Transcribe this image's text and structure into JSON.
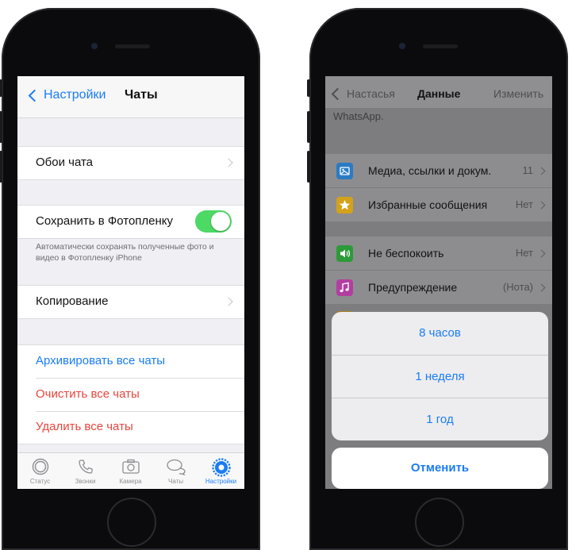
{
  "left_screen": {
    "nav": {
      "back_label": "Настройки",
      "title": "Чаты"
    },
    "wallpaper_label": "Обои чата",
    "save_to_camera_roll": {
      "label": "Сохранить в Фотопленку",
      "enabled": true
    },
    "save_note": "Автоматически сохранять полученные фото и видео в Фотопленку iPhone",
    "backup_label": "Копирование",
    "actions": {
      "archive_all": "Архивировать все чаты",
      "clear_all": "Очистить все чаты",
      "delete_all": "Удалить все чаты"
    },
    "tabs": [
      {
        "label": "Статус",
        "icon": "status-icon"
      },
      {
        "label": "Звонки",
        "icon": "phone-icon"
      },
      {
        "label": "Камера",
        "icon": "camera-icon"
      },
      {
        "label": "Чаты",
        "icon": "chats-icon"
      },
      {
        "label": "Настройки",
        "icon": "gear-icon",
        "active": true
      }
    ]
  },
  "right_screen": {
    "nav": {
      "back_label": "Настасья",
      "title": "Данные",
      "edit_label": "Изменить"
    },
    "subtitle": "WhatsApp.",
    "rows": [
      {
        "label": "Медиа, ссылки и докум.",
        "value": "11",
        "icon": "media-icon",
        "color": "#2a7bc4"
      },
      {
        "label": "Избранные сообщения",
        "value": "Нет",
        "icon": "star-icon",
        "color": "#d4a21a"
      },
      {
        "label": "Не беспокоить",
        "value": "Нет",
        "icon": "speaker-icon",
        "color": "#2d9a3a"
      },
      {
        "label": "Предупреждение",
        "value": "(Нота)",
        "icon": "music-note-icon",
        "color": "#b23fa0"
      }
    ],
    "mute_options": [
      "8 часов",
      "1 неделя",
      "1 год"
    ],
    "cancel_label": "Отменить"
  },
  "colors": {
    "accent": "#1a7cf5",
    "destructive": "#e8453c",
    "toggle_on": "#4cd964"
  }
}
